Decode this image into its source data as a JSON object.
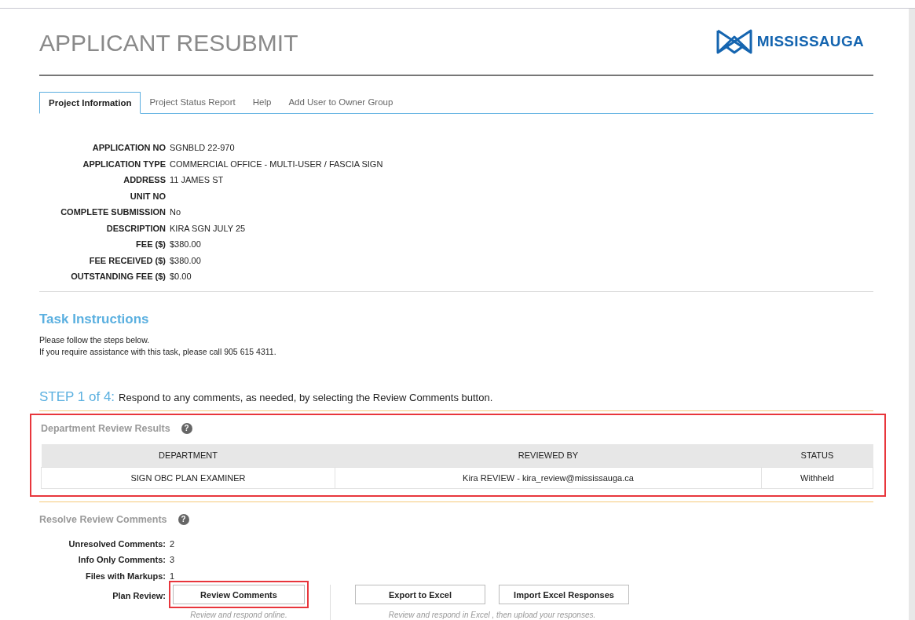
{
  "header": {
    "title": "APPLICANT RESUBMIT",
    "logo_text": "MISSISSAUGA"
  },
  "tabs": [
    {
      "label": "Project Information",
      "selected": true
    },
    {
      "label": "Project Status Report",
      "selected": false
    },
    {
      "label": "Help",
      "selected": false
    },
    {
      "label": "Add User to Owner Group",
      "selected": false
    }
  ],
  "project_info": [
    {
      "label": "APPLICATION NO",
      "value": "SGNBLD 22-970"
    },
    {
      "label": "APPLICATION TYPE",
      "value": "COMMERCIAL OFFICE - MULTI-USER / FASCIA SIGN"
    },
    {
      "label": "ADDRESS",
      "value": "11 JAMES ST"
    },
    {
      "label": "UNIT NO"
    },
    {
      "label": "COMPLETE SUBMISSION",
      "value": "No"
    },
    {
      "label": "DESCRIPTION",
      "value": "KIRA SGN JULY 25"
    },
    {
      "label": "FEE ($)",
      "value": "$380.00"
    },
    {
      "label": "FEE RECEIVED ($)",
      "value": "$380.00"
    },
    {
      "label": "OUTSTANDING FEE ($)",
      "value": "$0.00"
    }
  ],
  "task_instructions": {
    "heading": "Task Instructions",
    "lines": [
      "Please follow the steps below.",
      "If you require assistance with this task, please call 905 615 4311."
    ]
  },
  "step": {
    "label": "STEP 1 of 4:",
    "text": "Respond to any comments, as needed, by selecting the Review Comments button."
  },
  "department_review": {
    "heading": "Department Review Results",
    "help_icon": "?",
    "highlighted": true,
    "columns": [
      "DEPARTMENT",
      "REVIEWED BY",
      "STATUS"
    ],
    "rows": [
      [
        "SIGN OBC PLAN EXAMINER",
        "Kira REVIEW - kira_review@mississauga.ca",
        "Withheld"
      ]
    ]
  },
  "resolve_comments": {
    "heading": "Resolve Review Comments",
    "help_icon": "?",
    "stats": [
      {
        "label": "Unresolved Comments:",
        "value": "2"
      },
      {
        "label": "Info Only Comments:",
        "value": "3"
      },
      {
        "label": "Files with Markups:",
        "value": "1"
      }
    ],
    "plan_review_label": "Plan Review:",
    "online": {
      "button": "Review Comments",
      "highlighted": true,
      "caption": "Review and respond online."
    },
    "excel": {
      "buttons": [
        "Export to Excel",
        "Import Excel Responses"
      ],
      "caption": "Review and respond in Excel , then upload your responses."
    }
  }
}
